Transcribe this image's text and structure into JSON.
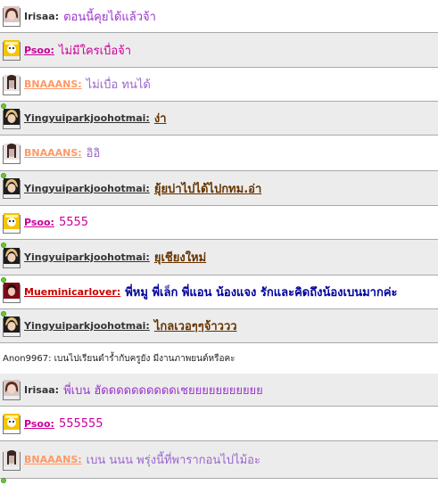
{
  "messages": [
    {
      "user": "Irisaa:",
      "text": "ตอนนี้คุยได้แล้วจ้า",
      "user_color": "#333333",
      "text_color": "#9933cc",
      "user_style": "plain",
      "text_bold": false,
      "text_underline": false,
      "bg": "plain",
      "avatar": "brunette",
      "online": false
    },
    {
      "user": "Psoo:",
      "text": "ไม่มีใครเบื่อจ้า",
      "user_color": "#cc0099",
      "text_color": "#cc0099",
      "user_style": "link",
      "text_bold": false,
      "text_underline": false,
      "bg": "grey",
      "avatar": "cartoon",
      "online": false
    },
    {
      "user": "BNAAANS:",
      "text": "ไม่เบื่อ ทนได้",
      "user_color": "#ff9966",
      "text_color": "#9966cc",
      "user_style": "link",
      "text_bold": false,
      "text_underline": false,
      "bg": "plain",
      "avatar": "model",
      "online": false
    },
    {
      "user": "Yingyuiparkjoohotmai:",
      "text": "ง่า",
      "user_color": "#333333",
      "text_color": "#663300",
      "user_style": "link",
      "text_bold": true,
      "text_underline": true,
      "bg": "grey",
      "avatar": "blonde",
      "online": true
    },
    {
      "user": "BNAAANS:",
      "text": "อิอิ",
      "user_color": "#ff9966",
      "text_color": "#9966cc",
      "user_style": "link",
      "text_bold": false,
      "text_underline": false,
      "bg": "plain",
      "avatar": "model",
      "online": false
    },
    {
      "user": "Yingyuiparkjoohotmai:",
      "text": "ยุ้ยบ่าไปได้ไปกทม.อ่า",
      "user_color": "#333333",
      "text_color": "#663300",
      "user_style": "link",
      "text_bold": true,
      "text_underline": true,
      "bg": "grey",
      "avatar": "blonde",
      "online": true
    },
    {
      "user": "Psoo:",
      "text": "5555",
      "user_color": "#cc0099",
      "text_color": "#cc0099",
      "user_style": "link",
      "text_bold": false,
      "text_underline": false,
      "bg": "plain",
      "avatar": "cartoon",
      "online": false
    },
    {
      "user": "Yingyuiparkjoohotmai:",
      "text": "ยุเชียงใหม่",
      "user_color": "#333333",
      "text_color": "#663300",
      "user_style": "link",
      "text_bold": true,
      "text_underline": true,
      "bg": "grey",
      "avatar": "blonde",
      "online": true
    },
    {
      "user": "Mueminicarlover:",
      "text": "พี่หมู พี่เล็ก พี่แอน น้องแจง รักและคิดถึงน้องเบนมากค่ะ",
      "user_color": "#cc0000",
      "text_color": "#000099",
      "user_style": "link",
      "text_bold": true,
      "text_underline": false,
      "bg": "plain",
      "avatar": "red",
      "online": true
    },
    {
      "user": "Yingyuiparkjoohotmai:",
      "text": "ไกลเวอๆๆจ้าววว",
      "user_color": "#333333",
      "text_color": "#663300",
      "user_style": "link",
      "text_bold": true,
      "text_underline": true,
      "bg": "grey",
      "avatar": "blonde",
      "online": true
    },
    {
      "system": true,
      "text": "Anon9967: เบนไปเรียนดำร้ำกับครูยัง มีงานภาพยนต์หรือคะ"
    },
    {
      "user": "Irisaa:",
      "text": "พี่เบน ฮัดดดดดดดดดดเชยยยยยยยยยยย",
      "user_color": "#333333",
      "text_color": "#9933cc",
      "user_style": "plain",
      "text_bold": false,
      "text_underline": false,
      "bg": "grey",
      "avatar": "brunette",
      "online": false
    },
    {
      "user": "Psoo:",
      "text": "555555",
      "user_color": "#cc0099",
      "text_color": "#cc0099",
      "user_style": "link",
      "text_bold": false,
      "text_underline": false,
      "bg": "plain",
      "avatar": "cartoon",
      "online": false
    },
    {
      "user": "BNAAANS:",
      "text": "เบน นนน พรุ่งนี้ที่พารากอนไปไม้อะ",
      "user_color": "#ff9966",
      "text_color": "#9966cc",
      "user_style": "link",
      "text_bold": false,
      "text_underline": false,
      "bg": "grey",
      "avatar": "model",
      "online": false
    },
    {
      "user": "",
      "text": "",
      "user_color": "#333333",
      "text_color": "#333333",
      "user_style": "link",
      "text_bold": false,
      "text_underline": false,
      "bg": "plain",
      "avatar": "",
      "online": true
    }
  ]
}
